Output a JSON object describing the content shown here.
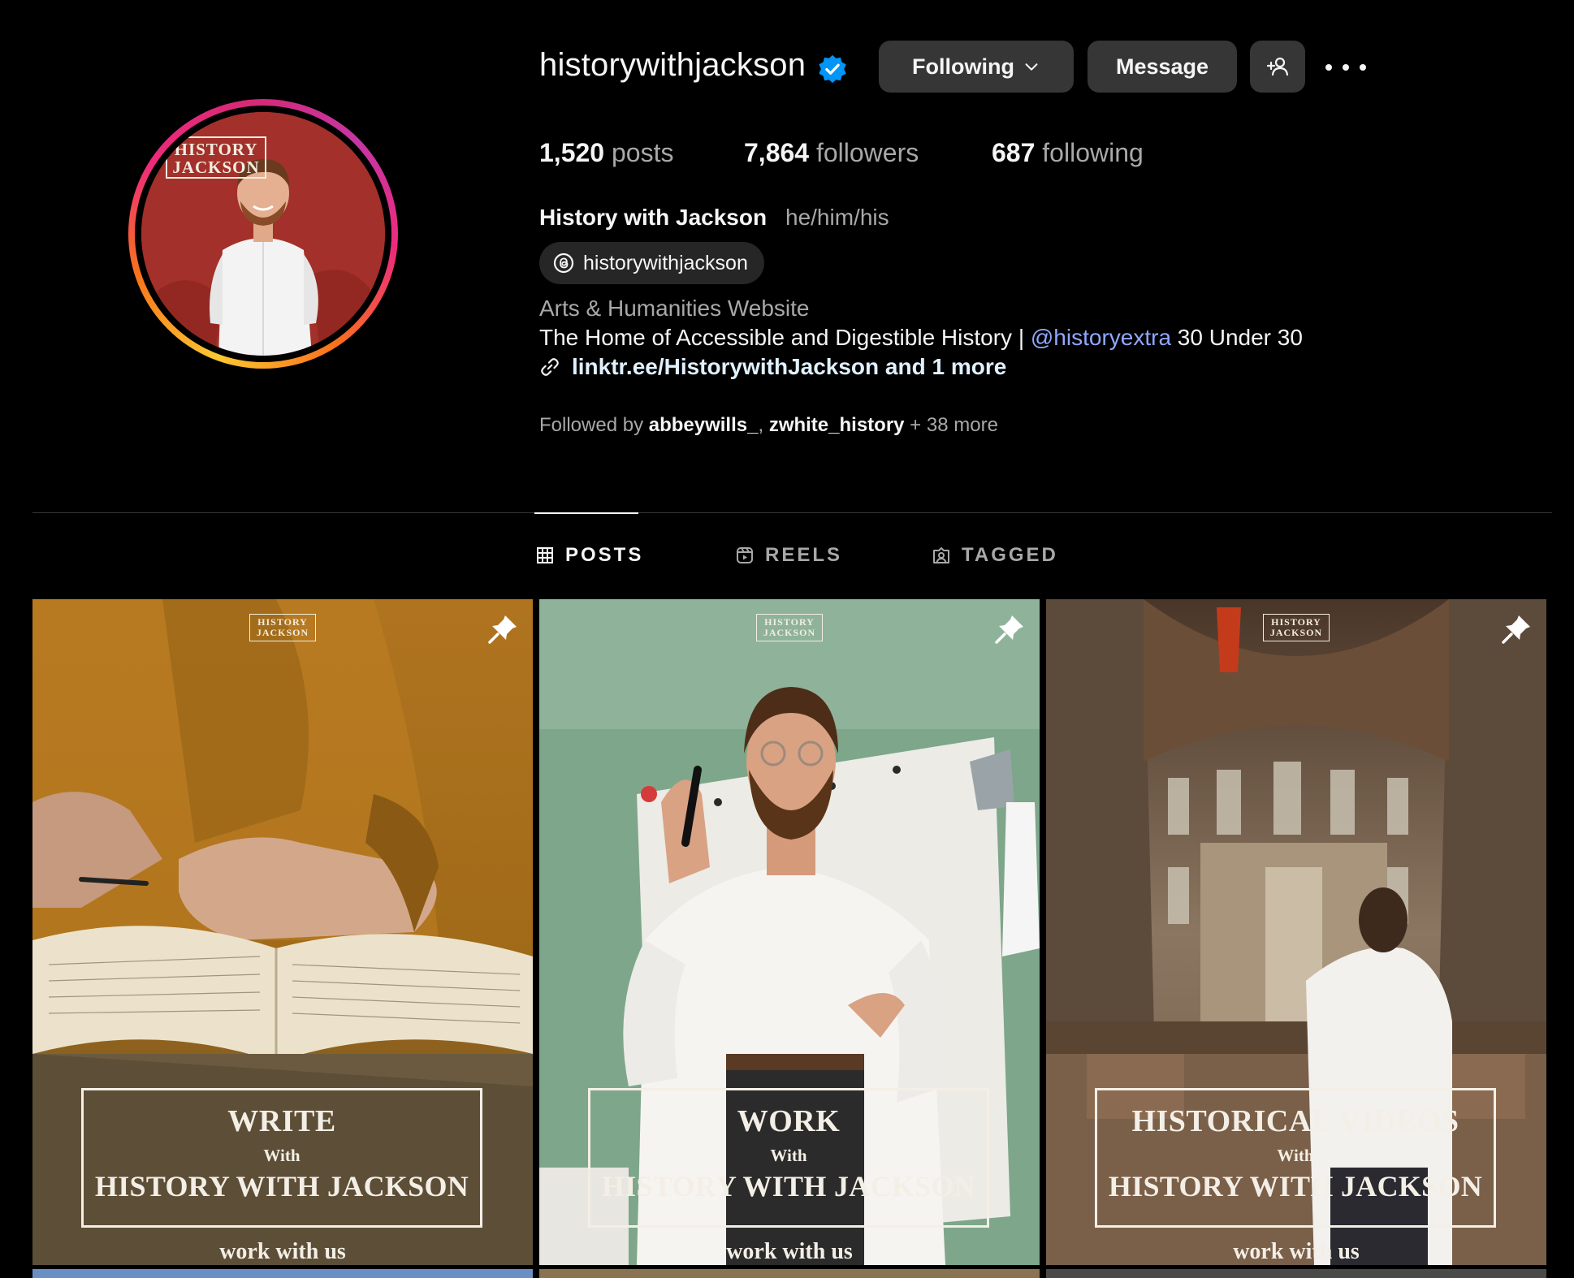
{
  "profile": {
    "username": "historywithjackson",
    "verified_icon": "verified-badge-icon",
    "avatar_logo_line1": "HISTORY",
    "avatar_logo_line2": "JACKSON",
    "full_name": "History with Jackson",
    "pronouns": "he/him/his",
    "threads_handle": "historywithjackson",
    "category": "Arts & Humanities Website",
    "bio_prefix": "The Home of Accessible and Digestible History | ",
    "bio_mention": "@historyextra",
    "bio_suffix": " 30 Under 30",
    "link_text": "linktr.ee/HistorywithJackson and 1 more",
    "followed_by_prefix": "Followed by ",
    "followed_by_user1": "abbeywills_",
    "followed_by_sep": ", ",
    "followed_by_user2": "zwhite_history",
    "followed_by_suffix": " + 38 more"
  },
  "actions": {
    "following_label": "Following",
    "message_label": "Message"
  },
  "stats": {
    "posts_count": "1,520",
    "posts_label": " posts",
    "followers_count": "7,864",
    "followers_label": " followers",
    "following_count": "687",
    "following_label": " following"
  },
  "tabs": [
    {
      "label": "POSTS",
      "active": true
    },
    {
      "label": "REELS",
      "active": false
    },
    {
      "label": "TAGGED",
      "active": false
    }
  ],
  "posts": [
    {
      "logo1": "HISTORY",
      "logo2": "JACKSON",
      "title": "WRITE",
      "with": "With",
      "brand": "HISTORY WITH JACKSON",
      "cta": "work with us",
      "pinned": true
    },
    {
      "logo1": "HISTORY",
      "logo2": "JACKSON",
      "title": "WORK",
      "with": "With",
      "brand": "HISTORY WITH JACKSON",
      "cta": "work with us",
      "pinned": true
    },
    {
      "logo1": "HISTORY",
      "logo2": "JACKSON",
      "title": "HISTORICAL VIDEOS",
      "with": "With",
      "brand": "HISTORY WITH JACKSON",
      "cta": "work with us",
      "pinned": true
    }
  ],
  "colors": {
    "background": "#000000",
    "button_bg": "#363636",
    "muted_text": "#a8a8a8",
    "mention": "#8fa8ff",
    "verified": "#0095f6"
  }
}
